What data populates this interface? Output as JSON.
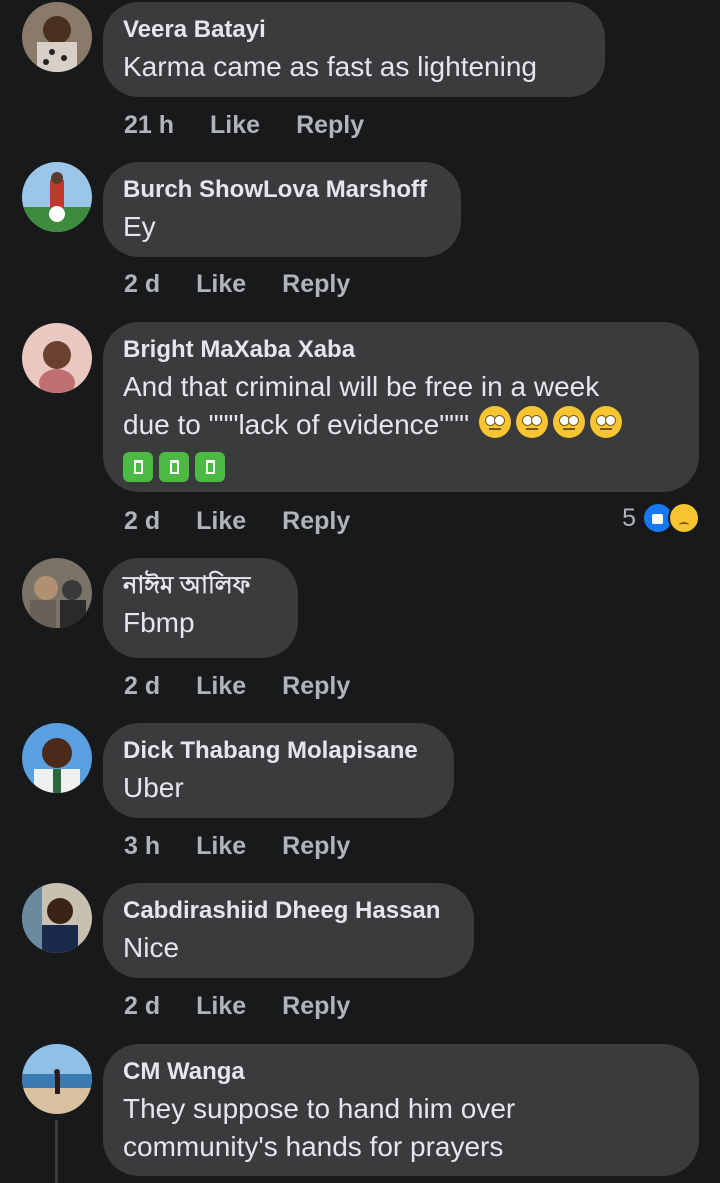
{
  "comments": [
    {
      "author": "Veera Batayi",
      "text": "Karma came as fast as lightening",
      "time": "21 h",
      "like": "Like",
      "reply": "Reply"
    },
    {
      "author": "Burch ShowLova Marshoff",
      "text": "Ey",
      "time": "2 d",
      "like": "Like",
      "reply": "Reply"
    },
    {
      "author": "Bright MaXaba Xaba",
      "text_line1": "And that criminal will be free in a week",
      "text_line2": "due to \"\"\"lack of evidence\"\"\"",
      "time": "2 d",
      "like": "Like",
      "reply": "Reply",
      "reaction_count": "5",
      "emojis": [
        "rolling-eyes-emoji",
        "rolling-eyes-emoji",
        "rolling-eyes-emoji",
        "rolling-eyes-emoji"
      ],
      "bins": [
        "litter-bin-emoji",
        "litter-bin-emoji",
        "litter-bin-emoji"
      ]
    },
    {
      "author": "নাঈম আলিফ",
      "text": "Fbmp",
      "time": "2 d",
      "like": "Like",
      "reply": "Reply"
    },
    {
      "author": "Dick Thabang Molapisane",
      "text": "Uber",
      "time": "3 h",
      "like": "Like",
      "reply": "Reply"
    },
    {
      "author": "Cabdirashiid Dheeg Hassan",
      "text": "Nice",
      "time": "2 d",
      "like": "Like",
      "reply": "Reply"
    },
    {
      "author": "CM Wanga",
      "text_line1": "They suppose to hand him over",
      "text_line2": "community's hands for prayers"
    }
  ],
  "colors": {
    "background": "#18191a",
    "bubble": "#3a3b3c",
    "text": "#e4e6eb",
    "secondary": "#b0b3b8",
    "like_blue": "#1877f2"
  }
}
